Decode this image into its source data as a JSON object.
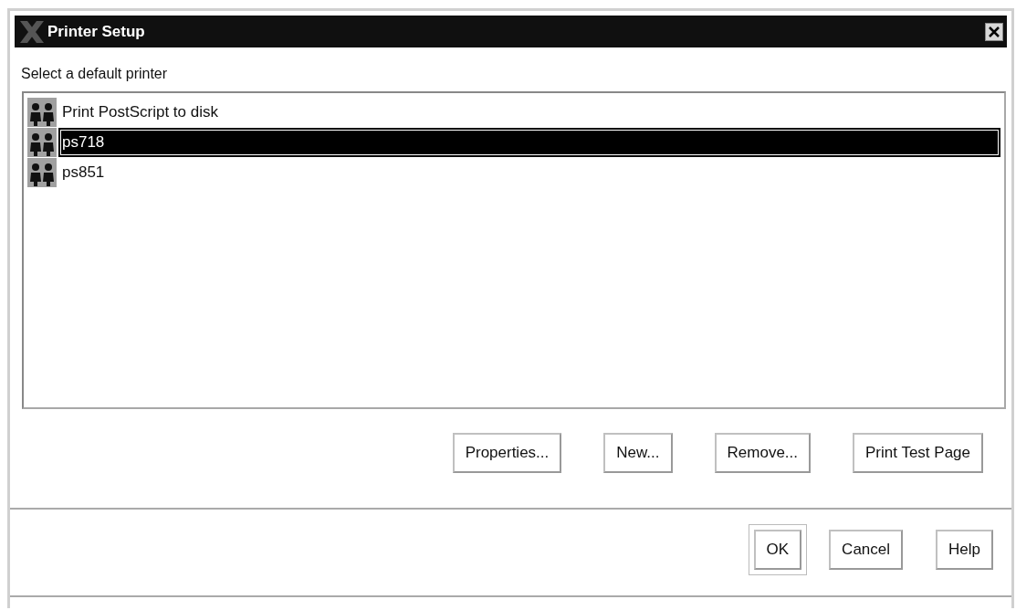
{
  "window": {
    "title": "Printer Setup"
  },
  "prompt": "Select a default printer",
  "printers": [
    {
      "name": "Print PostScript to disk",
      "selected": false
    },
    {
      "name": "ps718",
      "selected": true
    },
    {
      "name": "ps851",
      "selected": false
    }
  ],
  "actions": [
    "Properties...",
    "New...",
    "Remove...",
    "Print Test Page"
  ],
  "dialog_buttons": [
    {
      "label": "OK",
      "default": true
    },
    {
      "label": "Cancel",
      "default": false
    },
    {
      "label": "Help",
      "default": false
    }
  ]
}
